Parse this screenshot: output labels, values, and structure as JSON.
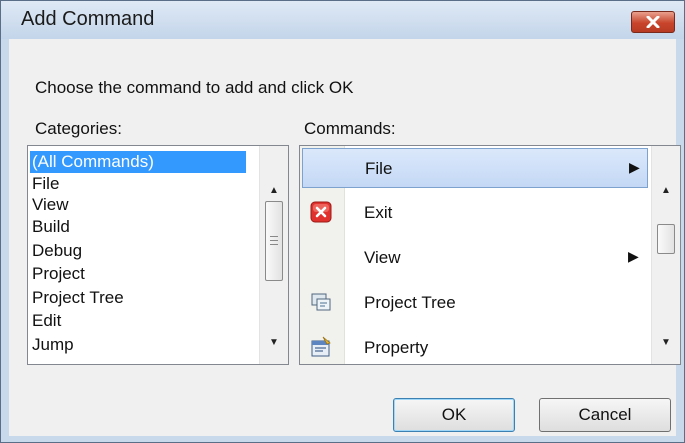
{
  "dialog": {
    "title": "Add Command",
    "instruction": "Choose the command to add and click OK"
  },
  "categories": {
    "label": "Categories:",
    "selected": "(All Commands)",
    "items": [
      "(All Commands)",
      "File",
      "View",
      "Build",
      "Debug",
      "Project",
      "Project Tree",
      "Edit",
      "Jump"
    ]
  },
  "commands": {
    "label": "Commands:",
    "items": [
      {
        "label": "File",
        "icon": "none",
        "submenu": true,
        "highlighted": true
      },
      {
        "label": "Exit",
        "icon": "exit-icon",
        "submenu": false
      },
      {
        "label": "View",
        "icon": "none",
        "submenu": true
      },
      {
        "label": "Project Tree",
        "icon": "project-tree-icon",
        "submenu": false
      },
      {
        "label": "Property",
        "icon": "property-icon",
        "submenu": false
      }
    ]
  },
  "buttons": {
    "ok": "OK",
    "cancel": "Cancel"
  },
  "colors": {
    "selection": "#3399ff",
    "title_bar": "#c9d9ec",
    "close_button": "#c8452c"
  }
}
